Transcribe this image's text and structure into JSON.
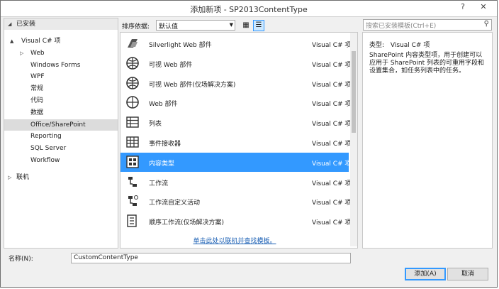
{
  "window": {
    "title": "添加新项 - SP2013ContentType",
    "help": "?",
    "close": "✕"
  },
  "tree": {
    "installed": "已安装",
    "items": [
      {
        "label": "Visual C# 项",
        "indent": 1,
        "arrow": "▲"
      },
      {
        "label": "Web",
        "indent": 2,
        "arrow": "▷"
      },
      {
        "label": "Windows Forms",
        "indent": 2,
        "arrow": ""
      },
      {
        "label": "WPF",
        "indent": 2,
        "arrow": ""
      },
      {
        "label": "常规",
        "indent": 2,
        "arrow": ""
      },
      {
        "label": "代码",
        "indent": 2,
        "arrow": ""
      },
      {
        "label": "数据",
        "indent": 2,
        "arrow": ""
      },
      {
        "label": "Office/SharePoint",
        "indent": 2,
        "arrow": "",
        "selected": true
      },
      {
        "label": "Reporting",
        "indent": 2,
        "arrow": ""
      },
      {
        "label": "SQL Server",
        "indent": 2,
        "arrow": ""
      },
      {
        "label": "Workflow",
        "indent": 2,
        "arrow": ""
      }
    ],
    "online": "联机"
  },
  "toolbar": {
    "sort_label": "排序依据:",
    "sort_value": "默认值"
  },
  "templates": [
    {
      "name": "Silverlight Web 部件",
      "type": "Visual C# 项",
      "icon": "silverlight-webpart-icon"
    },
    {
      "name": "可视 Web 部件",
      "type": "Visual C# 项",
      "icon": "visual-webpart-icon"
    },
    {
      "name": "可视 Web 部件(仅场解决方案)",
      "type": "Visual C# 项",
      "icon": "visual-webpart-farm-icon"
    },
    {
      "name": "Web 部件",
      "type": "Visual C# 项",
      "icon": "webpart-icon"
    },
    {
      "name": "列表",
      "type": "Visual C# 项",
      "icon": "list-icon"
    },
    {
      "name": "事件接收器",
      "type": "Visual C# 项",
      "icon": "event-receiver-icon"
    },
    {
      "name": "内容类型",
      "type": "Visual C# 项",
      "icon": "content-type-icon",
      "selected": true
    },
    {
      "name": "工作流",
      "type": "Visual C# 项",
      "icon": "workflow-icon"
    },
    {
      "name": "工作流自定义活动",
      "type": "Visual C# 项",
      "icon": "workflow-activity-icon"
    },
    {
      "name": "顺序工作流(仅场解决方案)",
      "type": "Visual C# 项",
      "icon": "sequential-workflow-icon"
    }
  ],
  "online_link": "单击此处以联机并查找模板。",
  "search": {
    "placeholder": "搜索已安装模板(Ctrl+E)"
  },
  "details": {
    "type_label": "类型:",
    "type_value": "Visual C# 项",
    "description": "SharePoint 内容类型项，用于创建可以应用于 SharePoint 列表的可重用字段和设置集合，如任务列表中的任务。"
  },
  "name_field": {
    "label": "名称(N):",
    "value": "CustomContentType"
  },
  "buttons": {
    "add": "添加(A)",
    "cancel": "取消"
  },
  "colors": {
    "selection": "#3399ff",
    "link": "#1a5fb4"
  }
}
